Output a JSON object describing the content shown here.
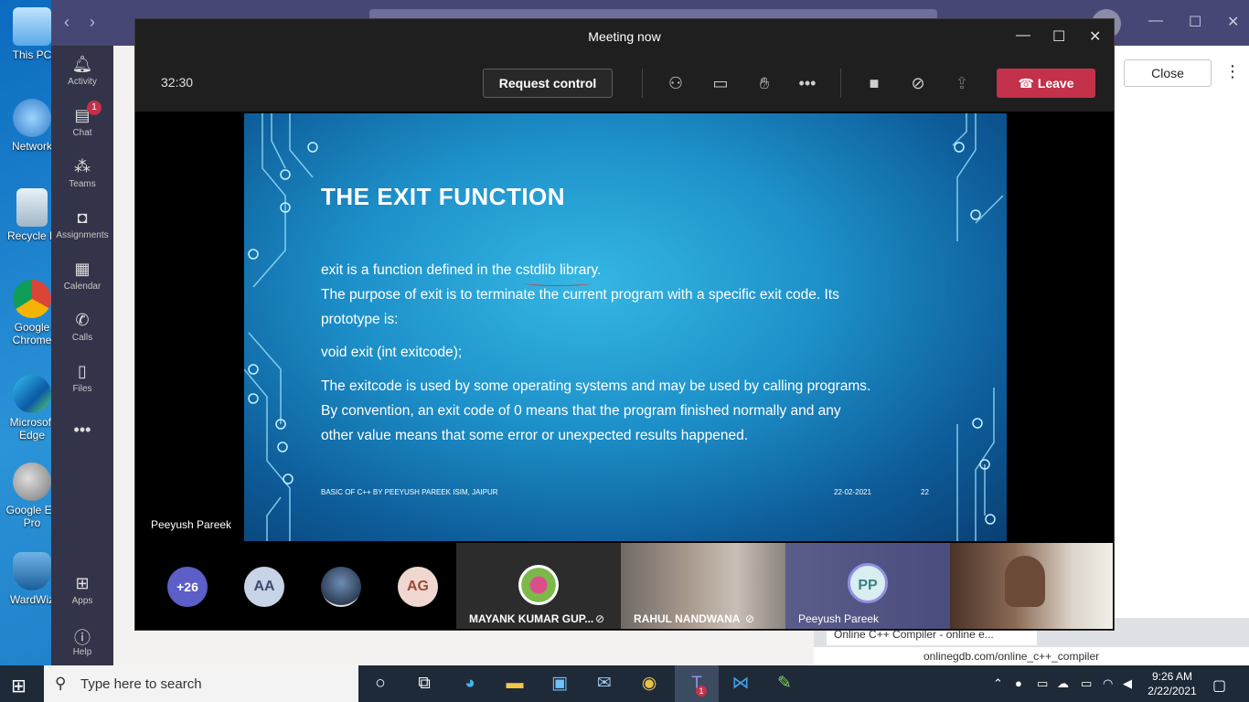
{
  "desktop": {
    "icons": [
      {
        "label": "This PC"
      },
      {
        "label": "Network"
      },
      {
        "label": "Recycle B"
      },
      {
        "label": "Google Chrome"
      },
      {
        "label": "Microsoft Edge"
      },
      {
        "label": "Google Ea Pro"
      },
      {
        "label": "WardWiz"
      }
    ]
  },
  "teams": {
    "rail": [
      {
        "label": "Activity",
        "icon": "bell-icon"
      },
      {
        "label": "Chat",
        "icon": "chat-icon",
        "badge": "1"
      },
      {
        "label": "Teams",
        "icon": "teams-icon"
      },
      {
        "label": "Assignments",
        "icon": "assignments-icon"
      },
      {
        "label": "Calendar",
        "icon": "calendar-icon"
      },
      {
        "label": "Calls",
        "icon": "phone-icon"
      },
      {
        "label": "Files",
        "icon": "files-icon"
      },
      {
        "label": "Apps",
        "icon": "apps-icon"
      },
      {
        "label": "Help",
        "icon": "help-icon"
      }
    ],
    "close_label": "Close"
  },
  "meeting": {
    "title": "Meeting now",
    "timer": "32:30",
    "request_control": "Request control",
    "leave": "Leave",
    "presenter": "Peeyush Pareek",
    "slide": {
      "title": "THE EXIT FUNCTION",
      "lines": [
        "exit is a function defined in the cstdlib library.",
        "The purpose of exit is to terminate the current program with a specific exit code. Its",
        "prototype is:",
        "void exit (int exitcode);",
        "The exitcode is used by some operating systems and may be used by calling programs.",
        "By convention, an exit code of 0 means that the program finished normally and any",
        "other value means that some error or unexpected results happened."
      ],
      "footer_left": "BASIC OF C++ BY PEEYUSH PAREEK  ISIM, JAIPUR",
      "footer_date": "22-02-2021",
      "footer_page": "22"
    },
    "participants": {
      "overflow": "+26",
      "avatars": [
        {
          "initials": "AA",
          "bg": "#c7d3e6",
          "fg": "#3b4d6e"
        },
        {
          "initials": "AG",
          "bg": "#f0d7cf",
          "fg": "#9c4a36"
        }
      ],
      "tiles": [
        {
          "name": "MAYANK KUMAR GUP..."
        },
        {
          "name": "RAHUL NANDWANA"
        },
        {
          "name": "Peeyush Pareek",
          "initials": "PP"
        }
      ]
    }
  },
  "browser": {
    "tab_title": "Online C++ Compiler - online e...",
    "url": "onlinegdb.com/online_c++_compiler"
  },
  "taskbar": {
    "search_placeholder": "Type here to search",
    "time": "9:26 AM",
    "date": "2/22/2021",
    "teams_badge": "1"
  },
  "colors": {
    "leave": "#c4314b",
    "teams_purple": "#464775",
    "rail": "#33344a"
  }
}
